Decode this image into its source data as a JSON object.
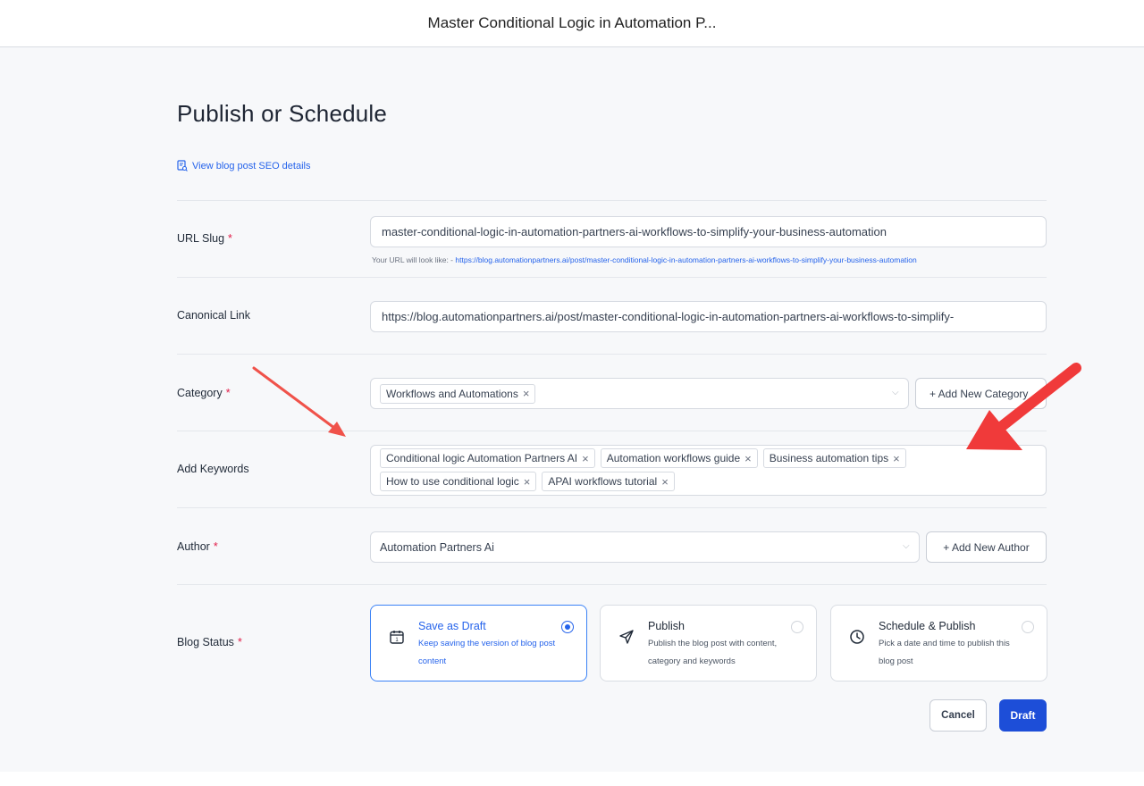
{
  "window": {
    "title": "Master Conditional Logic in Automation P..."
  },
  "page": {
    "heading": "Publish or Schedule",
    "seo_link": "View blog post SEO details"
  },
  "url_slug": {
    "label": "URL Slug",
    "required": "*",
    "value": "master-conditional-logic-in-automation-partners-ai-workflows-to-simplify-your-business-automation",
    "hint_prefix": "Your URL will look like: - ",
    "hint_url": "https://blog.automationpartners.ai/post/master-conditional-logic-in-automation-partners-ai-workflows-to-simplify-your-business-automation"
  },
  "canonical": {
    "label": "Canonical Link",
    "value": "https://blog.automationpartners.ai/post/master-conditional-logic-in-automation-partners-ai-workflows-to-simplify-"
  },
  "category": {
    "label": "Category",
    "required": "*",
    "selected": "Workflows and Automations",
    "add_button": "+ Add New Category"
  },
  "keywords": {
    "label": "Add Keywords",
    "tags": [
      "Conditional logic Automation Partners AI",
      "Automation workflows guide",
      "Business automation tips",
      "How to use conditional logic",
      "APAI workflows tutorial"
    ]
  },
  "author": {
    "label": "Author",
    "required": "*",
    "value": "Automation Partners Ai",
    "add_button": "+ Add New Author"
  },
  "blog_status": {
    "label": "Blog Status",
    "required": "*",
    "options": [
      {
        "title": "Save as Draft",
        "description": "Keep saving the version of blog post content",
        "icon": "calendar-icon",
        "selected": true
      },
      {
        "title": "Publish",
        "description": "Publish the blog post with content, category and keywords",
        "icon": "send-icon",
        "selected": false
      },
      {
        "title": "Schedule & Publish",
        "description": "Pick a date and time to publish this blog post",
        "icon": "clock-icon",
        "selected": false
      }
    ]
  },
  "actions": {
    "cancel": "Cancel",
    "primary": "Draft"
  },
  "colors": {
    "accent": "#2563eb",
    "primary_button": "#1d4ed8",
    "annotation_arrow": "#f03a3a",
    "required": "#e11d48"
  }
}
